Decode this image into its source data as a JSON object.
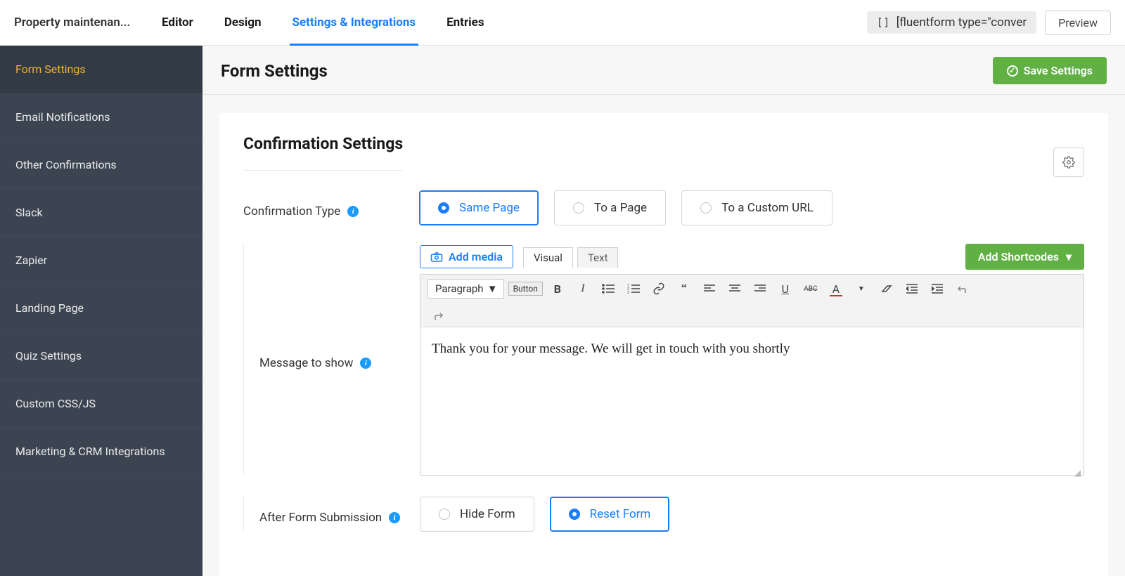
{
  "form_name": "Property maintenan...",
  "top_tabs": {
    "editor": "Editor",
    "design": "Design",
    "settings": "Settings & Integrations",
    "entries": "Entries"
  },
  "shortcode_snippet": "[fluentform type=\"conver",
  "preview_label": "Preview",
  "sidebar": {
    "items": [
      "Form Settings",
      "Email Notifications",
      "Other Confirmations",
      "Slack",
      "Zapier",
      "Landing Page",
      "Quiz Settings",
      "Custom CSS/JS",
      "Marketing & CRM Integrations"
    ],
    "active_index": 0
  },
  "page_title": "Form Settings",
  "save_label": "Save Settings",
  "section_title": "Confirmation Settings",
  "confirmation_type": {
    "label": "Confirmation Type",
    "options": [
      "Same Page",
      "To a Page",
      "To a Custom URL"
    ],
    "selected_index": 0
  },
  "message": {
    "label": "Message to show",
    "add_media": "Add media",
    "tab_visual": "Visual",
    "tab_text": "Text",
    "add_shortcodes": "Add Shortcodes",
    "paragraph_select": "Paragraph",
    "button_label": "Button",
    "content": "Thank you for your message. We will get in touch with you shortly"
  },
  "after_submission": {
    "label": "After Form Submission",
    "options": [
      "Hide Form",
      "Reset Form"
    ],
    "selected_index": 1
  },
  "icons": {
    "info": "i",
    "check": "✓",
    "chevron_down": "▾",
    "camera": "📷",
    "abc_strike": "ABC"
  }
}
